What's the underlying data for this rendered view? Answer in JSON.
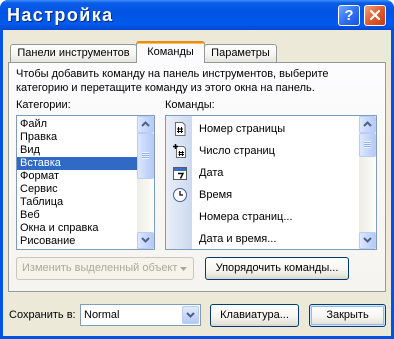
{
  "window": {
    "title": "Настройка",
    "help_button_label": "?"
  },
  "tabs": [
    {
      "label": "Панели инструментов",
      "active": false
    },
    {
      "label": "Команды",
      "active": true
    },
    {
      "label": "Параметры",
      "active": false
    }
  ],
  "commands_page": {
    "description_lines": [
      "Чтобы добавить команду на панель инструментов, выберите",
      "категорию и перетащите команду из этого окна на панель."
    ],
    "categories_label": "Категории:",
    "commands_label": "Команды:",
    "categories": [
      "Файл",
      "Правка",
      "Вид",
      "Вставка",
      "Формат",
      "Сервис",
      "Таблица",
      "Веб",
      "Окна и справка",
      "Рисование"
    ],
    "selected_category_index": 3,
    "commands": [
      {
        "label": "Номер страницы",
        "icon": "page-number-icon"
      },
      {
        "label": "Число страниц",
        "icon": "page-count-icon"
      },
      {
        "label": "Дата",
        "icon": "calendar-icon"
      },
      {
        "label": "Время",
        "icon": "clock-icon"
      },
      {
        "label": "Номера страниц...",
        "icon": null
      },
      {
        "label": "Дата и время...",
        "icon": null
      }
    ],
    "modify_selection_button": {
      "label": "Изменить выделенный объект",
      "enabled": false
    },
    "rearrange_commands_button": {
      "label": "Упорядочить команды..."
    }
  },
  "footer": {
    "save_in_label": "Сохранить в:",
    "save_in_value": "Normal",
    "keyboard_button_label": "Клавиатура...",
    "close_button_label": "Закрыть"
  },
  "colors": {
    "window_frame": "#0054E3",
    "dialog_face": "#ECE9D8",
    "selection": "#316AC5",
    "active_tab_accent": "#FFC83C",
    "close_button": "#E35B2B",
    "disabled_text": "#ACA899"
  }
}
